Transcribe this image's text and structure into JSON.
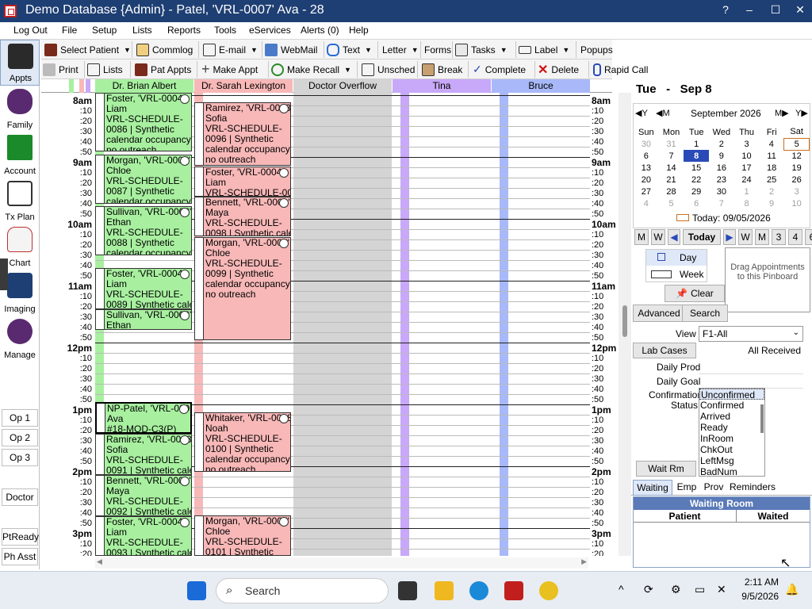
{
  "window": {
    "title": "Demo Database {Admin} - Patel, 'VRL-0007' Ava - 28",
    "help": "?",
    "minimize": "–",
    "maximize": "☐",
    "close": "✕"
  },
  "menu": [
    "Log Out",
    "File",
    "Setup",
    "Lists",
    "Reports",
    "Tools",
    "eServices",
    "Alerts (0)",
    "Help"
  ],
  "toolbar1": [
    "Select Patient",
    "Commlog",
    "E-mail",
    "WebMail",
    "Text",
    "Letter",
    "Forms",
    "Tasks",
    "Label",
    "Popups"
  ],
  "toolbar2": [
    "Print",
    "Lists",
    "Pat Appts",
    "Make Appt",
    "Make Recall",
    "Unsched",
    "Break",
    "Complete",
    "Delete",
    "Rapid Call"
  ],
  "nav": [
    "Appts",
    "Family",
    "Account",
    "Tx Plan",
    "Chart",
    "Imaging",
    "Manage"
  ],
  "op_buttons": [
    "Op 1",
    "Op 2",
    "Op 3",
    "Doctor",
    "PtReady",
    "Ph Asst"
  ],
  "columns": [
    "Dr. Brian Albert",
    "Dr. Sarah Lexington",
    "Doctor Overflow",
    "Tina",
    "Bruce"
  ],
  "hours": [
    "8am",
    "9am",
    "10am",
    "11am",
    "12pm",
    "1pm",
    "2pm",
    "3pm"
  ],
  "minutes": [
    ":10",
    ":20",
    ":30",
    ":40",
    ":50"
  ],
  "appointments_col1": [
    {
      "lines": [
        "Foster, 'VRL-0004'",
        "Liam",
        "VRL-SCHEDULE-",
        "0086 | Synthetic",
        "calendar occupancy |",
        "no outreach"
      ]
    },
    {
      "lines": [
        "Morgan, 'VRL-0005'",
        "Chloe",
        "VRL-SCHEDULE-",
        "0087 | Synthetic",
        "calendar occupancy |"
      ]
    },
    {
      "lines": [
        "Sullivan, 'VRL-0006'",
        "Ethan",
        "VRL-SCHEDULE-",
        "0088 | Synthetic",
        "calendar occupancy |"
      ]
    },
    {
      "lines": [
        "Foster, 'VRL-0004'",
        "Liam",
        "VRL-SCHEDULE-",
        "0089 | Synthetic cale"
      ]
    },
    {
      "lines": [
        "Sullivan, 'VRL-0006'",
        "Ethan"
      ]
    },
    {
      "lines": [
        "NP-Patel, 'VRL-0007'",
        "Ava",
        "#18-MOD-C3(P)"
      ]
    },
    {
      "lines": [
        "Ramirez, 'VRL-0003'",
        "Sofia",
        "VRL-SCHEDULE-",
        "0091 | Synthetic cale"
      ]
    },
    {
      "lines": [
        "Bennett, 'VRL-0001'",
        "Maya",
        "VRL-SCHEDULE-",
        "0092 | Synthetic cale"
      ]
    },
    {
      "lines": [
        "Foster, 'VRL-0004'",
        "Liam",
        "VRL-SCHEDULE-",
        "0093 | Synthetic cale"
      ]
    }
  ],
  "appointments_col2": [
    {
      "lines": [
        "Ramirez, 'VRL-0003'",
        "Sofia",
        "VRL-SCHEDULE-",
        "0096 | Synthetic",
        "calendar occupancy |",
        "no outreach"
      ]
    },
    {
      "lines": [
        "Foster, 'VRL-0004'",
        "Liam",
        "VRL-SCHEDULE-00"
      ]
    },
    {
      "lines": [
        "Bennett, 'VRL-0001'",
        "Maya",
        "VRL-SCHEDULE-",
        "0098 | Synthetic cale"
      ]
    },
    {
      "lines": [
        "Morgan, 'VRL-0005'",
        "Chloe",
        "VRL-SCHEDULE-",
        "0099 | Synthetic",
        "calendar occupancy |",
        "no outreach"
      ]
    },
    {
      "lines": [
        "Whitaker, 'VRL-0008'",
        "Noah",
        "VRL-SCHEDULE-",
        "0100 | Synthetic",
        "calendar occupancy |",
        "no outreach"
      ]
    },
    {
      "lines": [
        "Morgan, 'VRL-0005'",
        "Chloe",
        "VRL-SCHEDULE-",
        "0101 | Synthetic"
      ]
    }
  ],
  "date_header": {
    "day": "Tue",
    "dash": "-",
    "date": "Sep 8"
  },
  "calendar": {
    "month": "September 2026",
    "prev_year": "◀Y",
    "prev_month": "◀M",
    "next_month": "M▶",
    "next_year": "Y▶",
    "weekdays": [
      "Sun",
      "Mon",
      "Tue",
      "Wed",
      "Thu",
      "Fri",
      "Sat"
    ],
    "weeks": [
      [
        "30",
        "31",
        "1",
        "2",
        "3",
        "4",
        "5"
      ],
      [
        "6",
        "7",
        "8",
        "9",
        "10",
        "11",
        "12"
      ],
      [
        "13",
        "14",
        "15",
        "16",
        "17",
        "18",
        "19"
      ],
      [
        "20",
        "21",
        "22",
        "23",
        "24",
        "25",
        "26"
      ],
      [
        "27",
        "28",
        "29",
        "30",
        "1",
        "2",
        "3"
      ],
      [
        "4",
        "5",
        "6",
        "7",
        "8",
        "9",
        "10"
      ]
    ],
    "today_label": "Today: 09/05/2026"
  },
  "nav_buttons": [
    "M",
    "W",
    "Today",
    "W",
    "M",
    "3",
    "4",
    "6"
  ],
  "view_toggle": [
    "Day",
    "Week"
  ],
  "pinboard": "Drag Appointments to this Pinboard",
  "buttons": {
    "clear": "Clear",
    "advanced": "Advanced",
    "search": "Search",
    "lab_cases": "Lab Cases",
    "wait_rm": "Wait Rm"
  },
  "view": {
    "label": "View",
    "value": "F1-All"
  },
  "lab_status": "All Received",
  "daily_prod": "Daily Prod",
  "daily_goal": "Daily Goal",
  "confirmation": {
    "label1": "Confirmation",
    "label2": "Status",
    "items": [
      "Unconfirmed",
      "Confirmed",
      "Arrived",
      "Ready",
      "InRoom",
      "ChkOut",
      "LeftMsg",
      "BadNum"
    ]
  },
  "tabs": [
    "Waiting",
    "Emp",
    "Prov",
    "Reminders"
  ],
  "waiting_room": {
    "title": "Waiting Room",
    "col_patient": "Patient",
    "col_waited": "Waited"
  },
  "taskbar": {
    "search": "Search",
    "time": "2:11 AM",
    "date": "9/5/2026"
  },
  "colors": {
    "titlebar": "#1e3f73",
    "green_appt": "#a8f0a0",
    "pink_appt": "#f8b8b8",
    "overflow": "#d4d4d4",
    "purple": "#c8a8f8"
  }
}
